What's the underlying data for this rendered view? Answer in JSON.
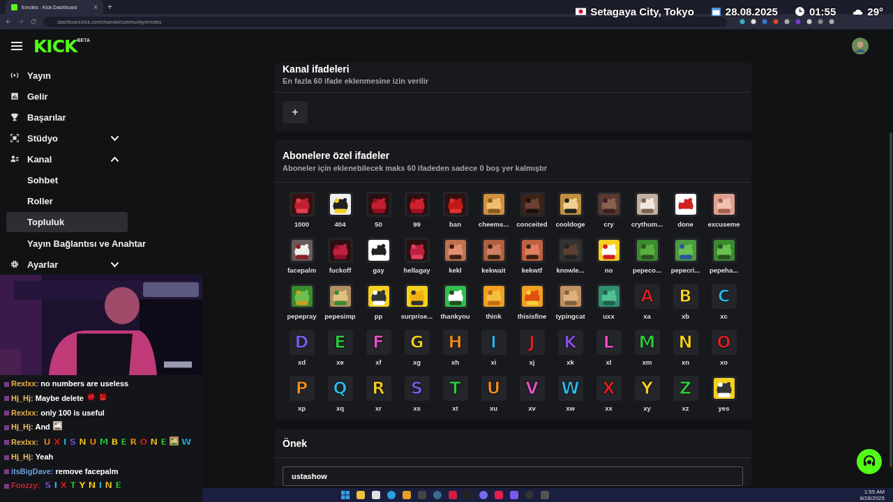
{
  "browser": {
    "tab": {
      "title": "Emotes - Kick Dashboard",
      "close": "×",
      "selected": true
    },
    "new_tab": "+",
    "url": "dashboard.kick.com/channel/community/emotes"
  },
  "overlay": {
    "location": "Setagaya City, Tokyo",
    "date": "28.08.2025",
    "time": "01:55",
    "temperature": "29°"
  },
  "header": {
    "logo": "KICK",
    "logo_badge": "BETA"
  },
  "sidebar": {
    "items": [
      {
        "label": "Yayın",
        "selected": false
      },
      {
        "label": "Gelir",
        "selected": false
      },
      {
        "label": "Başarılar",
        "selected": false
      },
      {
        "label": "Stüdyo",
        "selected": false,
        "expanded": false
      },
      {
        "label": "Kanal",
        "selected": false,
        "expanded": true,
        "children": [
          {
            "label": "Sohbet",
            "selected": false
          },
          {
            "label": "Roller",
            "selected": false
          },
          {
            "label": "Topluluk",
            "selected": true
          },
          {
            "label": "Yayın Bağlantısı ve Anahtar",
            "selected": false
          }
        ]
      },
      {
        "label": "Ayarlar",
        "selected": false,
        "expanded": false
      }
    ]
  },
  "channel_emotes": {
    "title": "Kanal ifadeleri",
    "subtitle": "En fazla 60 ifade eklenmesine izin verilir",
    "add_button": "+"
  },
  "subscriber_emotes": {
    "title": "Abonelere özel ifadeler",
    "subtitle": "Aboneler için eklenebilecek maks 60 ifadeden sadece 0 boş yer kalmıştır",
    "emotes": [
      {
        "label": "1000",
        "kind": "picture"
      },
      {
        "label": "404",
        "kind": "picture"
      },
      {
        "label": "50",
        "kind": "picture"
      },
      {
        "label": "99",
        "kind": "picture"
      },
      {
        "label": "ban",
        "kind": "picture"
      },
      {
        "label": "cheems...",
        "kind": "picture"
      },
      {
        "label": "conceited",
        "kind": "picture"
      },
      {
        "label": "cooldoge",
        "kind": "picture"
      },
      {
        "label": "cry",
        "kind": "picture"
      },
      {
        "label": "crythum...",
        "kind": "picture"
      },
      {
        "label": "done",
        "kind": "picture"
      },
      {
        "label": "excuseme",
        "kind": "picture"
      },
      {
        "label": "facepalm",
        "kind": "picture"
      },
      {
        "label": "fuckoff",
        "kind": "picture"
      },
      {
        "label": "gay",
        "kind": "picture"
      },
      {
        "label": "hellagay",
        "kind": "picture"
      },
      {
        "label": "kekl",
        "kind": "picture"
      },
      {
        "label": "kekwait",
        "kind": "picture"
      },
      {
        "label": "kekwtf",
        "kind": "picture"
      },
      {
        "label": "knowle...",
        "kind": "picture"
      },
      {
        "label": "no",
        "kind": "picture"
      },
      {
        "label": "pepeco...",
        "kind": "picture"
      },
      {
        "label": "pepecri...",
        "kind": "picture"
      },
      {
        "label": "pepeha...",
        "kind": "picture"
      },
      {
        "label": "pepepray",
        "kind": "picture"
      },
      {
        "label": "pepesimp",
        "kind": "picture"
      },
      {
        "label": "pp",
        "kind": "picture"
      },
      {
        "label": "surprise...",
        "kind": "picture"
      },
      {
        "label": "thankyou",
        "kind": "picture"
      },
      {
        "label": "think",
        "kind": "picture"
      },
      {
        "label": "thisisfine",
        "kind": "picture"
      },
      {
        "label": "typingcat",
        "kind": "picture"
      },
      {
        "label": "uxx",
        "kind": "picture"
      },
      {
        "label": "xa",
        "kind": "letter",
        "glyph": "A",
        "color": "#e02020"
      },
      {
        "label": "xb",
        "kind": "letter",
        "glyph": "B",
        "color": "#f5d020"
      },
      {
        "label": "xc",
        "kind": "letter",
        "glyph": "C",
        "color": "#2ab8e8"
      },
      {
        "label": "xd",
        "kind": "letter",
        "glyph": "D",
        "color": "#7a5cf0"
      },
      {
        "label": "xe",
        "kind": "letter",
        "glyph": "E",
        "color": "#2ecc40"
      },
      {
        "label": "xf",
        "kind": "letter",
        "glyph": "F",
        "color": "#f050c8"
      },
      {
        "label": "xg",
        "kind": "letter",
        "glyph": "G",
        "color": "#f5d020"
      },
      {
        "label": "xh",
        "kind": "letter",
        "glyph": "H",
        "color": "#f08a1c"
      },
      {
        "label": "xi",
        "kind": "letter",
        "glyph": "I",
        "color": "#2ab8e8"
      },
      {
        "label": "xj",
        "kind": "letter",
        "glyph": "J",
        "color": "#e02020"
      },
      {
        "label": "xk",
        "kind": "letter",
        "glyph": "K",
        "color": "#8a50e0"
      },
      {
        "label": "xl",
        "kind": "letter",
        "glyph": "L",
        "color": "#f050c8"
      },
      {
        "label": "xm",
        "kind": "letter",
        "glyph": "M",
        "color": "#2ecc40"
      },
      {
        "label": "xn",
        "kind": "letter",
        "glyph": "N",
        "color": "#f5d020"
      },
      {
        "label": "xo",
        "kind": "letter",
        "glyph": "O",
        "color": "#e02020"
      },
      {
        "label": "xp",
        "kind": "letter",
        "glyph": "P",
        "color": "#f08a1c"
      },
      {
        "label": "xq",
        "kind": "letter",
        "glyph": "Q",
        "color": "#2ab8e8"
      },
      {
        "label": "xr",
        "kind": "letter",
        "glyph": "R",
        "color": "#f5d020"
      },
      {
        "label": "xs",
        "kind": "letter",
        "glyph": "S",
        "color": "#7a5cf0"
      },
      {
        "label": "xt",
        "kind": "letter",
        "glyph": "T",
        "color": "#2ecc40"
      },
      {
        "label": "xu",
        "kind": "letter",
        "glyph": "U",
        "color": "#f08a1c"
      },
      {
        "label": "xv",
        "kind": "letter",
        "glyph": "V",
        "color": "#f050c8"
      },
      {
        "label": "xw",
        "kind": "letter",
        "glyph": "W",
        "color": "#2ab8e8"
      },
      {
        "label": "xx",
        "kind": "letter",
        "glyph": "X",
        "color": "#e02020"
      },
      {
        "label": "xy",
        "kind": "letter",
        "glyph": "Y",
        "color": "#f5d020"
      },
      {
        "label": "xz",
        "kind": "letter",
        "glyph": "Z",
        "color": "#2ecc40"
      },
      {
        "label": "yes",
        "kind": "picture"
      }
    ]
  },
  "prefix": {
    "title": "Önek",
    "value": "ustashow"
  },
  "chat": {
    "messages": [
      {
        "user": "Rexlxx:",
        "color": "#e8b04a",
        "text": "no numbers are useless"
      },
      {
        "user": "Hj_Hj:",
        "color": "#f0c060",
        "text": "Maybe delete",
        "emotes": [
          {
            "kind": "picture"
          },
          {
            "kind": "picture"
          }
        ]
      },
      {
        "user": "Rexlxx:",
        "color": "#e8b04a",
        "text": "only 100 is useful"
      },
      {
        "user": "Hj_Hj:",
        "color": "#f0c060",
        "text": "And",
        "emotes": [
          {
            "kind": "picture"
          }
        ]
      },
      {
        "user": "Rexlxx:",
        "color": "#e8b04a",
        "emotes": [
          {
            "kind": "letter",
            "glyph": "U",
            "color": "#f08a1c"
          },
          {
            "kind": "letter",
            "glyph": "X",
            "color": "#e02020"
          },
          {
            "kind": "letter",
            "glyph": "I",
            "color": "#2ab8e8"
          },
          {
            "kind": "letter",
            "glyph": "S",
            "color": "#7a5cf0"
          },
          {
            "kind": "letter",
            "glyph": "N",
            "color": "#f5d020"
          },
          {
            "kind": "letter",
            "glyph": "U",
            "color": "#f08a1c"
          },
          {
            "kind": "letter",
            "glyph": "M",
            "color": "#2ecc40"
          },
          {
            "kind": "letter",
            "glyph": "B",
            "color": "#f5d020"
          },
          {
            "kind": "letter",
            "glyph": "E",
            "color": "#2ecc40"
          },
          {
            "kind": "letter",
            "glyph": "R",
            "color": "#f5a020"
          },
          {
            "kind": "letter",
            "glyph": "O",
            "color": "#e02020"
          },
          {
            "kind": "letter",
            "glyph": "N",
            "color": "#f5d020"
          },
          {
            "kind": "letter",
            "glyph": "E",
            "color": "#2ecc40"
          },
          {
            "kind": "picture"
          },
          {
            "kind": "letter",
            "glyph": "W",
            "color": "#2ab8e8"
          }
        ]
      },
      {
        "user": "Hj_Hj:",
        "color": "#f0c060",
        "text": "Yeah"
      },
      {
        "user": "itsBigDave:",
        "color": "#6a9ee0",
        "text": "remove facepalm"
      },
      {
        "user": "Foozzy:",
        "color": "#c02838",
        "emotes": [
          {
            "kind": "letter",
            "glyph": "S",
            "color": "#7a5cf0"
          },
          {
            "kind": "letter",
            "glyph": "I",
            "color": "#2ab8e8"
          },
          {
            "kind": "letter",
            "glyph": "X",
            "color": "#e02020"
          },
          {
            "kind": "letter",
            "glyph": "T",
            "color": "#2ecc40"
          },
          {
            "kind": "letter",
            "glyph": "Y",
            "color": "#f5d020"
          },
          {
            "kind": "letter",
            "glyph": "N",
            "color": "#f5d020"
          },
          {
            "kind": "letter",
            "glyph": "I",
            "color": "#2ab8e8"
          },
          {
            "kind": "letter",
            "glyph": "N",
            "color": "#f5d020"
          },
          {
            "kind": "letter",
            "glyph": "E",
            "color": "#2ecc40"
          }
        ]
      }
    ]
  },
  "taskbar": {
    "time": "1:55 AM",
    "date": "8/28/2025"
  }
}
